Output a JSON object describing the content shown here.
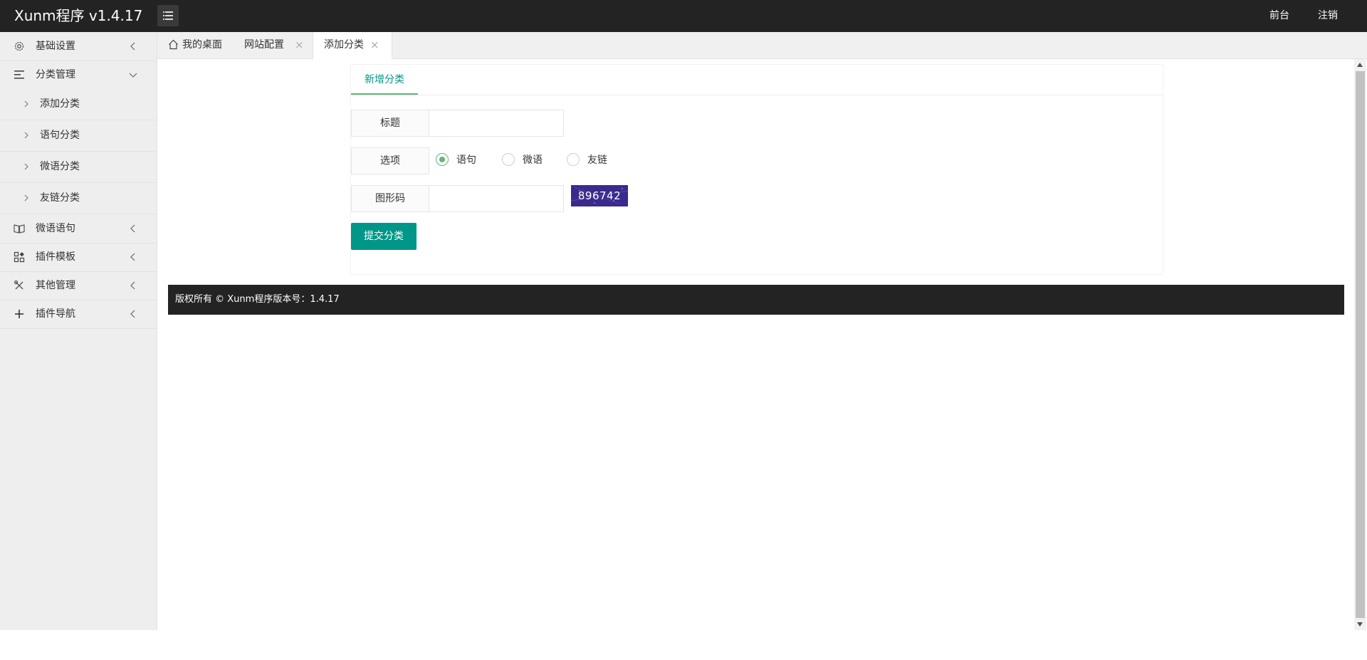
{
  "header": {
    "app_title": "Xunm程序 v1.4.17",
    "menu_toggle_icon": "list-icon",
    "links": {
      "front": "前台",
      "logout": "注销"
    }
  },
  "sidebar": {
    "items": [
      {
        "label": "基础设置",
        "icon": "gear-icon",
        "expanded": false
      },
      {
        "label": "分类管理",
        "icon": "align-left-icon",
        "expanded": true,
        "children": [
          "添加分类",
          "语句分类",
          "微语分类",
          "友链分类"
        ]
      },
      {
        "label": "微语语句",
        "icon": "book-icon",
        "expanded": false
      },
      {
        "label": "插件模板",
        "icon": "app-grid-icon",
        "expanded": false
      },
      {
        "label": "其他管理",
        "icon": "tools-icon",
        "expanded": false
      },
      {
        "label": "插件导航",
        "icon": "plus-icon",
        "expanded": false
      }
    ]
  },
  "tabs": [
    {
      "label": "我的桌面",
      "icon": "home-icon",
      "closable": false
    },
    {
      "label": "网站配置",
      "closable": true
    },
    {
      "label": "添加分类",
      "closable": true,
      "active": true
    }
  ],
  "form": {
    "card_tab": "新增分类",
    "title_label": "标题",
    "title_value": "",
    "option_label": "选项",
    "options": [
      "语句",
      "微语",
      "友链"
    ],
    "selected_option": "语句",
    "captcha_label": "图形码",
    "captcha_value": "",
    "captcha_text": "896742",
    "submit_label": "提交分类"
  },
  "footer": {
    "copyright": "版权所有 © Xunm程序版本号：1.4.17"
  },
  "colors": {
    "accent": "#009688",
    "radio_green": "#5FB878",
    "header_bg": "#232323",
    "sidebar_bg": "#eeeeee"
  }
}
